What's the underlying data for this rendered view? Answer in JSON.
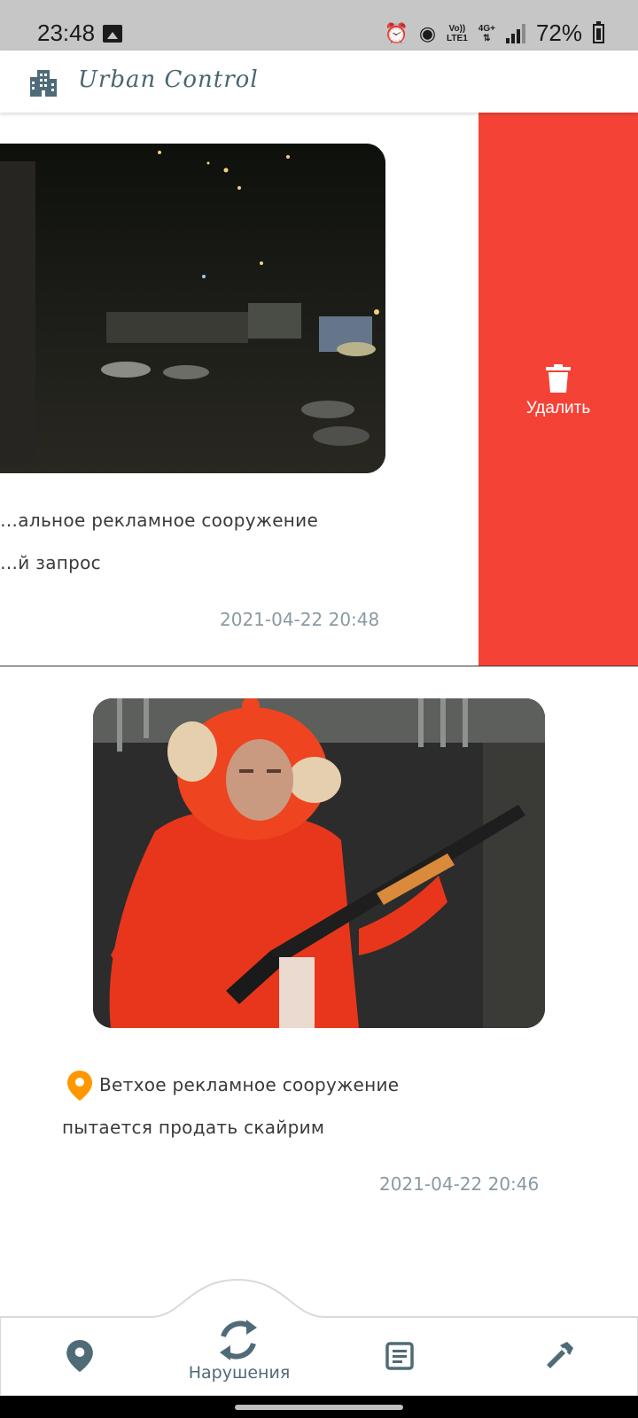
{
  "status_bar": {
    "time": "23:48",
    "network_top": "Vo))",
    "network_bottom": "LTE1",
    "network_type": "4G+",
    "battery": "72%"
  },
  "header": {
    "app_title": "Urban Control",
    "logo_icon": "city-buildings-icon"
  },
  "cards": [
    {
      "title": "…альное рекламное сооружение",
      "description": "…й запрос",
      "date": "2021-04-22 20:48"
    },
    {
      "title": "Ветхое рекламное сооружение",
      "description": "пытается продать скайрим",
      "date": "2021-04-22 20:46"
    }
  ],
  "swipe_action": {
    "label": "Удалить",
    "icon": "trash-icon",
    "color": "#f44336"
  },
  "bottom_nav": {
    "items": [
      {
        "icon": "map-pin-icon"
      },
      {
        "icon": "refresh-icon",
        "label": "Нарушения"
      },
      {
        "icon": "article-icon"
      },
      {
        "icon": "hammer-icon"
      }
    ]
  },
  "colors": {
    "accent": "#4f6b78",
    "pin": "#ff9800",
    "delete": "#f44336"
  }
}
